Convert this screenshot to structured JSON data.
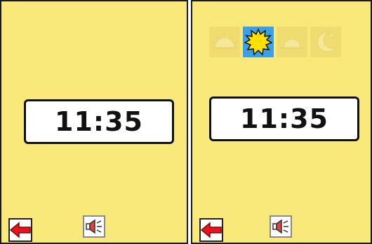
{
  "colors": {
    "panel_bg": "#f9e97a",
    "dim_icon_bg": "#f0dd72",
    "active_icon_bg": "#3aa0e8",
    "back_arrow": "#e8141c",
    "sun": "#ffe000"
  },
  "left_panel": {
    "time": "11:35",
    "back_icon": "red-left-arrow",
    "speaker_icon": "speaker-icon"
  },
  "right_panel": {
    "time": "11:35",
    "day_period_icons": [
      {
        "name": "sunrise-icon",
        "state": "inactive"
      },
      {
        "name": "sun-icon",
        "state": "selected"
      },
      {
        "name": "sunset-icon",
        "state": "inactive"
      },
      {
        "name": "moon-icon",
        "state": "inactive"
      }
    ],
    "back_icon": "red-left-arrow",
    "speaker_icon": "speaker-icon"
  }
}
